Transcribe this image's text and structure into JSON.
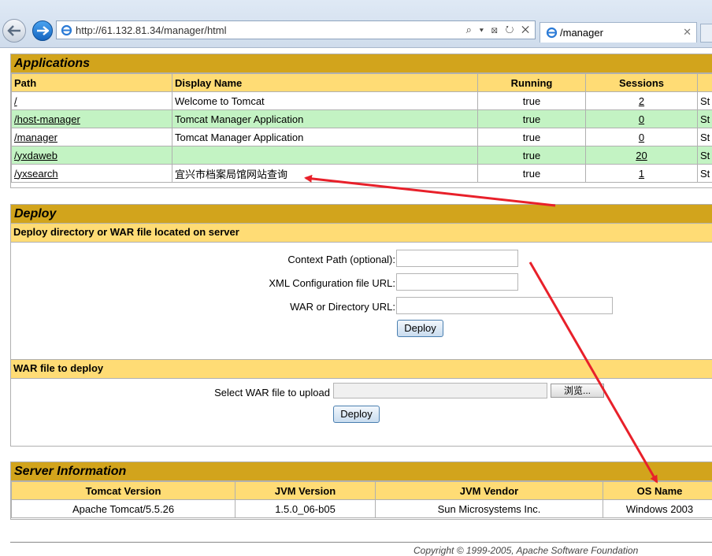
{
  "browser": {
    "url": "http://61.132.81.34/manager/html",
    "tab_title": "/manager",
    "tab_close": "✕",
    "address_tools": "⌕ ▾ ⊠ ↻ ✕"
  },
  "applications": {
    "heading": "Applications",
    "columns": [
      "Path",
      "Display Name",
      "Running",
      "Sessions",
      ""
    ],
    "rows": [
      {
        "path": "/",
        "display_name": "Welcome to Tomcat",
        "running": "true",
        "sessions": "2",
        "commands": "St"
      },
      {
        "path": "/host-manager",
        "display_name": "Tomcat Manager Application",
        "running": "true",
        "sessions": "0",
        "commands": "St"
      },
      {
        "path": "/manager",
        "display_name": "Tomcat Manager Application",
        "running": "true",
        "sessions": "0",
        "commands": "St"
      },
      {
        "path": "/yxdaweb",
        "display_name": "",
        "running": "true",
        "sessions": "20",
        "commands": "St"
      },
      {
        "path": "/yxsearch",
        "display_name": "宜兴市档案局馆网站查询",
        "running": "true",
        "sessions": "1",
        "commands": "St"
      }
    ]
  },
  "deploy": {
    "heading": "Deploy",
    "server_subheading": "Deploy directory or WAR file located on server",
    "context_path_label": "Context Path (optional):",
    "xml_config_label": "XML Configuration file URL:",
    "war_dir_label": "WAR or Directory URL:",
    "deploy_button": "Deploy",
    "war_subheading": "WAR file to deploy",
    "select_war_label": "Select WAR file to upload",
    "browse_button": "浏览...",
    "deploy_button2": "Deploy"
  },
  "server_info": {
    "heading": "Server Information",
    "columns": [
      "Tomcat Version",
      "JVM Version",
      "JVM Vendor",
      "OS Name"
    ],
    "values": [
      "Apache Tomcat/5.5.26",
      "1.5.0_06-b05",
      "Sun Microsystems Inc.",
      "Windows 2003"
    ]
  },
  "footer": {
    "copyright": "Copyright © 1999-2005, Apache Software Foundation"
  },
  "colors": {
    "section_header": "#d2a41c",
    "column_header": "#ffdc75",
    "alt_row": "#c3f3c3",
    "annotation_arrow": "#e8202a"
  }
}
